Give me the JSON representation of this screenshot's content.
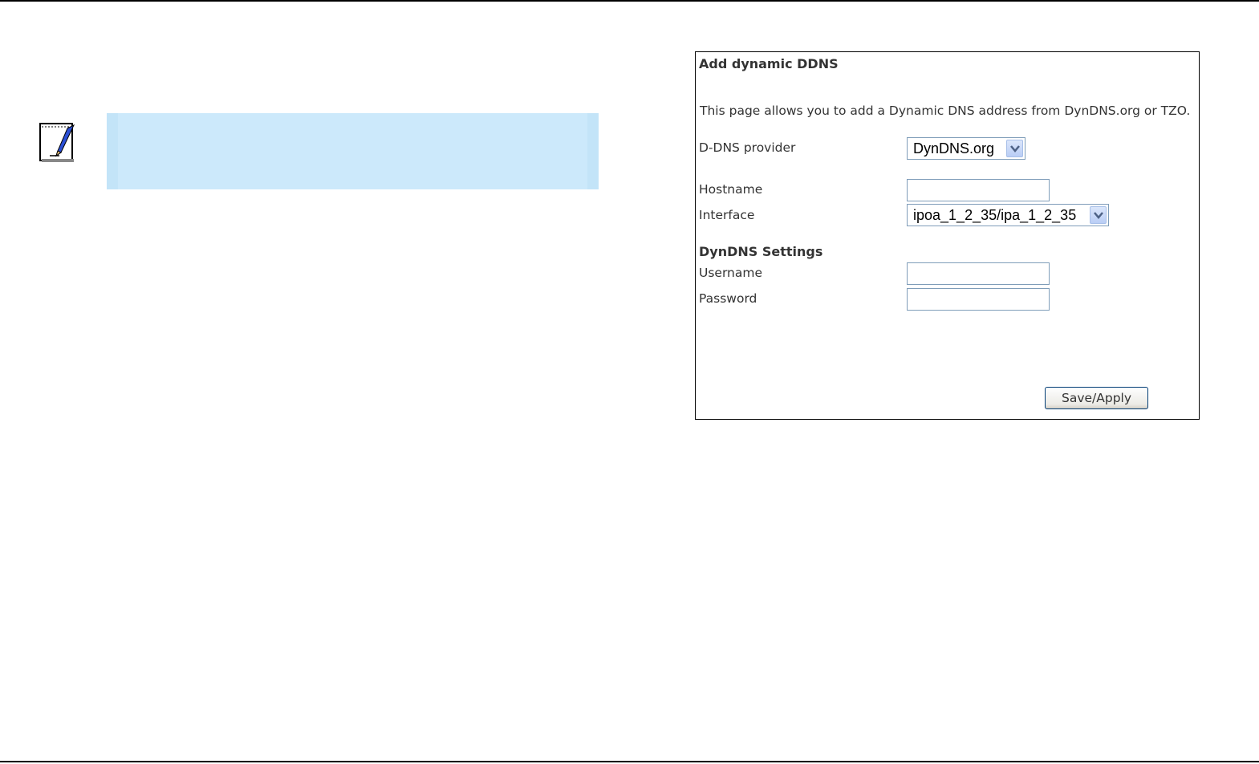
{
  "panel": {
    "title": "Add dynamic DDNS",
    "description": "This page allows you to add a Dynamic DNS address from DynDNS.org or TZO.",
    "provider_label": "D-DNS provider",
    "provider_value": "DynDNS.org",
    "hostname_label": "Hostname",
    "hostname_value": "",
    "interface_label": "Interface",
    "interface_value": "ipoa_1_2_35/ipa_1_2_35",
    "settings_title": "DynDNS Settings",
    "username_label": "Username",
    "username_value": "",
    "password_label": "Password",
    "password_value": "",
    "save_label": "Save/Apply"
  },
  "colors": {
    "note_box": "#cce9fb",
    "select_arrow": "#b9cdf5",
    "border": "#7f9db9"
  },
  "icons": {
    "note": "notepad-pencil-icon",
    "dropdown": "chevron-down-icon"
  }
}
